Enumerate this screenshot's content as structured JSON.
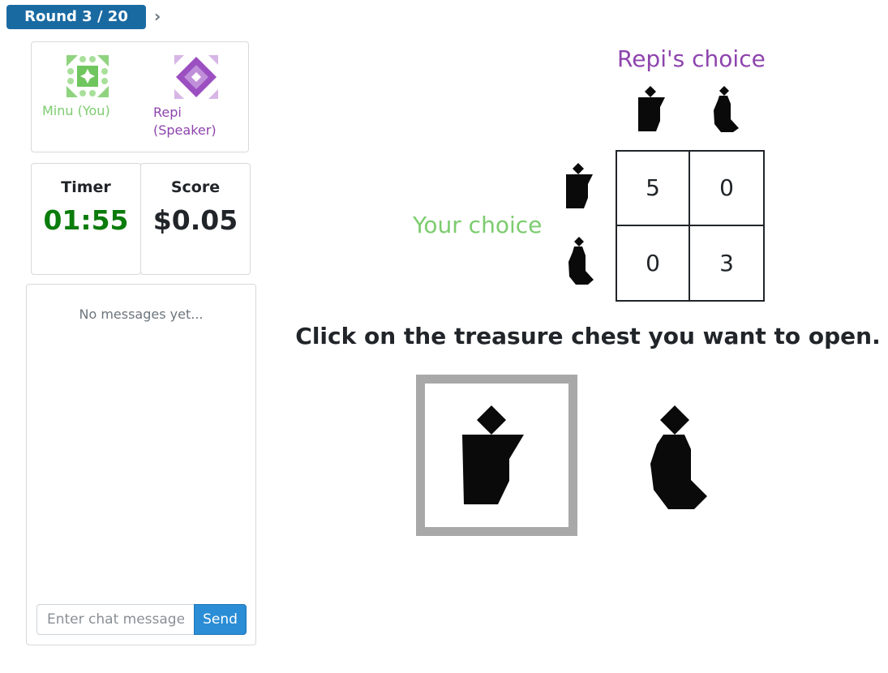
{
  "header": {
    "round_label": "Round 3 / 20",
    "next_icon": "chevron-right-icon"
  },
  "players": {
    "you": {
      "name": "Minu (You)",
      "color": "#7ccc6e",
      "avatar_icon": "green-quilt-avatar-icon"
    },
    "partner": {
      "name_line1": "Repi",
      "name_line2": "(Speaker)",
      "color": "#8e44ad",
      "avatar_icon": "purple-quilt-avatar-icon"
    }
  },
  "stats": {
    "timer_label": "Timer",
    "timer_value": "01:55",
    "timer_color": "#0b7c0b",
    "score_label": "Score",
    "score_value": "$0.05"
  },
  "chat": {
    "empty_text": "No messages yet...",
    "input_placeholder": "Enter chat message",
    "input_value": "",
    "send_label": "Send",
    "send_color": "#2a8dd6"
  },
  "game": {
    "col_header": "Repi's choice",
    "row_header": "Your choice",
    "options": [
      "flat-top-shape-icon",
      "round-bottom-shape-icon"
    ],
    "payoffs": [
      [
        "5",
        "0"
      ],
      [
        "0",
        "3"
      ]
    ],
    "instruction": "Click on the treasure chest you want to open.",
    "selected_option": "flat-top-shape-icon"
  }
}
